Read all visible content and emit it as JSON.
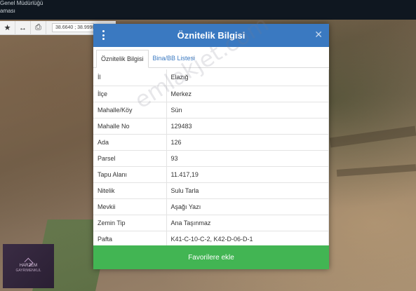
{
  "header": {
    "org_text": "Genel Müdürlüğü",
    "sub_text": "aması"
  },
  "toolbar": {
    "coordinates": "38.6640 ; 38.9990"
  },
  "logo": {
    "line1": "HARZEM",
    "line2": "GAYRIMENKUL"
  },
  "modal": {
    "title": "Öznitelik Bilgisi",
    "close_label": "✕",
    "tabs": [
      {
        "label": "Öznitelik Bilgisi",
        "active": true
      },
      {
        "label": "Bina/BB Listesi",
        "active": false
      }
    ],
    "rows": [
      {
        "key": "İl",
        "value": "Elazığ"
      },
      {
        "key": "İlçe",
        "value": "Merkez"
      },
      {
        "key": "Mahalle/Köy",
        "value": "Sün"
      },
      {
        "key": "Mahalle No",
        "value": "129483"
      },
      {
        "key": "Ada",
        "value": "126"
      },
      {
        "key": "Parsel",
        "value": "93"
      },
      {
        "key": "Tapu Alanı",
        "value": "11.417,19"
      },
      {
        "key": "Nitelik",
        "value": "Sulu Tarla"
      },
      {
        "key": "Mevkii",
        "value": "Aşağı Yazı"
      },
      {
        "key": "Zemin Tip",
        "value": "Ana Taşınmaz"
      },
      {
        "key": "Pafta",
        "value": "K41-C-10-C-2, K42-D-06-D-1"
      }
    ],
    "favorite_button": "Favorilere ekle",
    "watermark": "emlakjet.com"
  }
}
